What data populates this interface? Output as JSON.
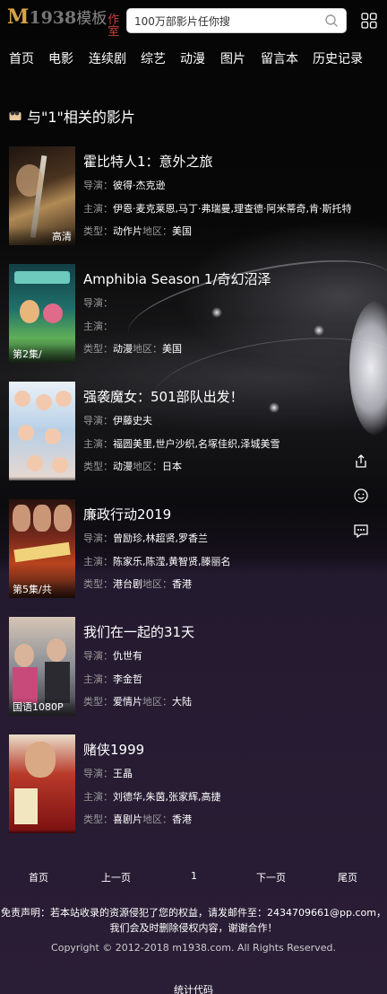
{
  "header": {
    "logo_m": "M",
    "logo_num": "1938",
    "logo_cn": "模板",
    "logo_cn2": "作室",
    "search_placeholder": "100万部影片任你搜"
  },
  "nav": [
    "首页",
    "电影",
    "连续剧",
    "综艺",
    "动漫",
    "图片",
    "留言本",
    "历史记录"
  ],
  "section_title": "与\"1\"相关的影片",
  "items": [
    {
      "title": "霍比特人1：意外之旅",
      "badge": "高清",
      "director_label": "导演：",
      "director": "彼得·杰克逊",
      "cast_label": "主演：",
      "cast": "伊恩·麦克莱恩,马丁·弗瑞曼,理查德·阿米蒂奇,肯·斯托特",
      "type_label": "类型：",
      "type": "动作片",
      "region_label": "地区：",
      "region": "美国",
      "poster_colors": [
        "#2a1d14",
        "#6b4a2a",
        "#c7a76a"
      ]
    },
    {
      "title": "Amphibia Season 1/奇幻沼泽",
      "badge": "第2集/",
      "director_label": "导演：",
      "director": "",
      "cast_label": "主演：",
      "cast": "",
      "type_label": "类型：",
      "type": "动漫",
      "region_label": "地区：",
      "region": "美国",
      "poster_colors": [
        "#0f3b3a",
        "#2f8a7a",
        "#7bd36a"
      ]
    },
    {
      "title": "强袭魔女：501部队出发！",
      "badge": "",
      "director_label": "导演：",
      "director": "伊藤史夫",
      "cast_label": "主演：",
      "cast": "福圆美里,世户沙织,名塚佳织,泽城美雪",
      "type_label": "类型：",
      "type": "动漫",
      "region_label": "地区：",
      "region": "日本",
      "poster_colors": [
        "#dfe9f2",
        "#8fb3d8",
        "#f1c7b3"
      ]
    },
    {
      "title": "廉政行动2019",
      "badge": "第5集/共",
      "director_label": "导演：",
      "director": "曾励珍,林超贤,罗香兰",
      "cast_label": "主演：",
      "cast": "陈家乐,陈滢,黄智贤,滕丽名",
      "type_label": "类型：",
      "type": "港台剧",
      "region_label": "地区：",
      "region": "香港",
      "poster_colors": [
        "#3a1410",
        "#a8321f",
        "#d9a14a"
      ]
    },
    {
      "title": "我们在一起的31天",
      "badge": "国语1080P",
      "director_label": "导演：",
      "director": "仇世有",
      "cast_label": "主演：",
      "cast": "李金哲",
      "type_label": "类型：",
      "type": "爱情片",
      "region_label": "地区：",
      "region": "大陆",
      "poster_colors": [
        "#c9b8a6",
        "#6f7c8a",
        "#2b2b2e"
      ]
    },
    {
      "title": "赌侠1999",
      "badge": "",
      "director_label": "导演：",
      "director": "王晶",
      "cast_label": "主演：",
      "cast": "刘德华,朱茵,张家辉,高捷",
      "type_label": "类型：",
      "type": "喜剧片",
      "region_label": "地区：",
      "region": "香港",
      "poster_colors": [
        "#7a0f0f",
        "#c43a2a",
        "#e9d3b8"
      ]
    }
  ],
  "pager": {
    "first": "首页",
    "prev": "上一页",
    "current": "1",
    "next": "下一页",
    "last": "尾页"
  },
  "footer": {
    "disclaimer_1": "免责声明：若本站收录的资源侵犯了您的权益，请发邮件至：2434709661@pp.com，",
    "disclaimer_2": "我们会及时删除侵权内容，谢谢合作！",
    "copyright": "Copyright © 2012-2018 m1938.com. All Rights Reserved.",
    "stats": "统计代码"
  },
  "floating": [
    "share-icon",
    "smile-icon",
    "comment-icon"
  ]
}
